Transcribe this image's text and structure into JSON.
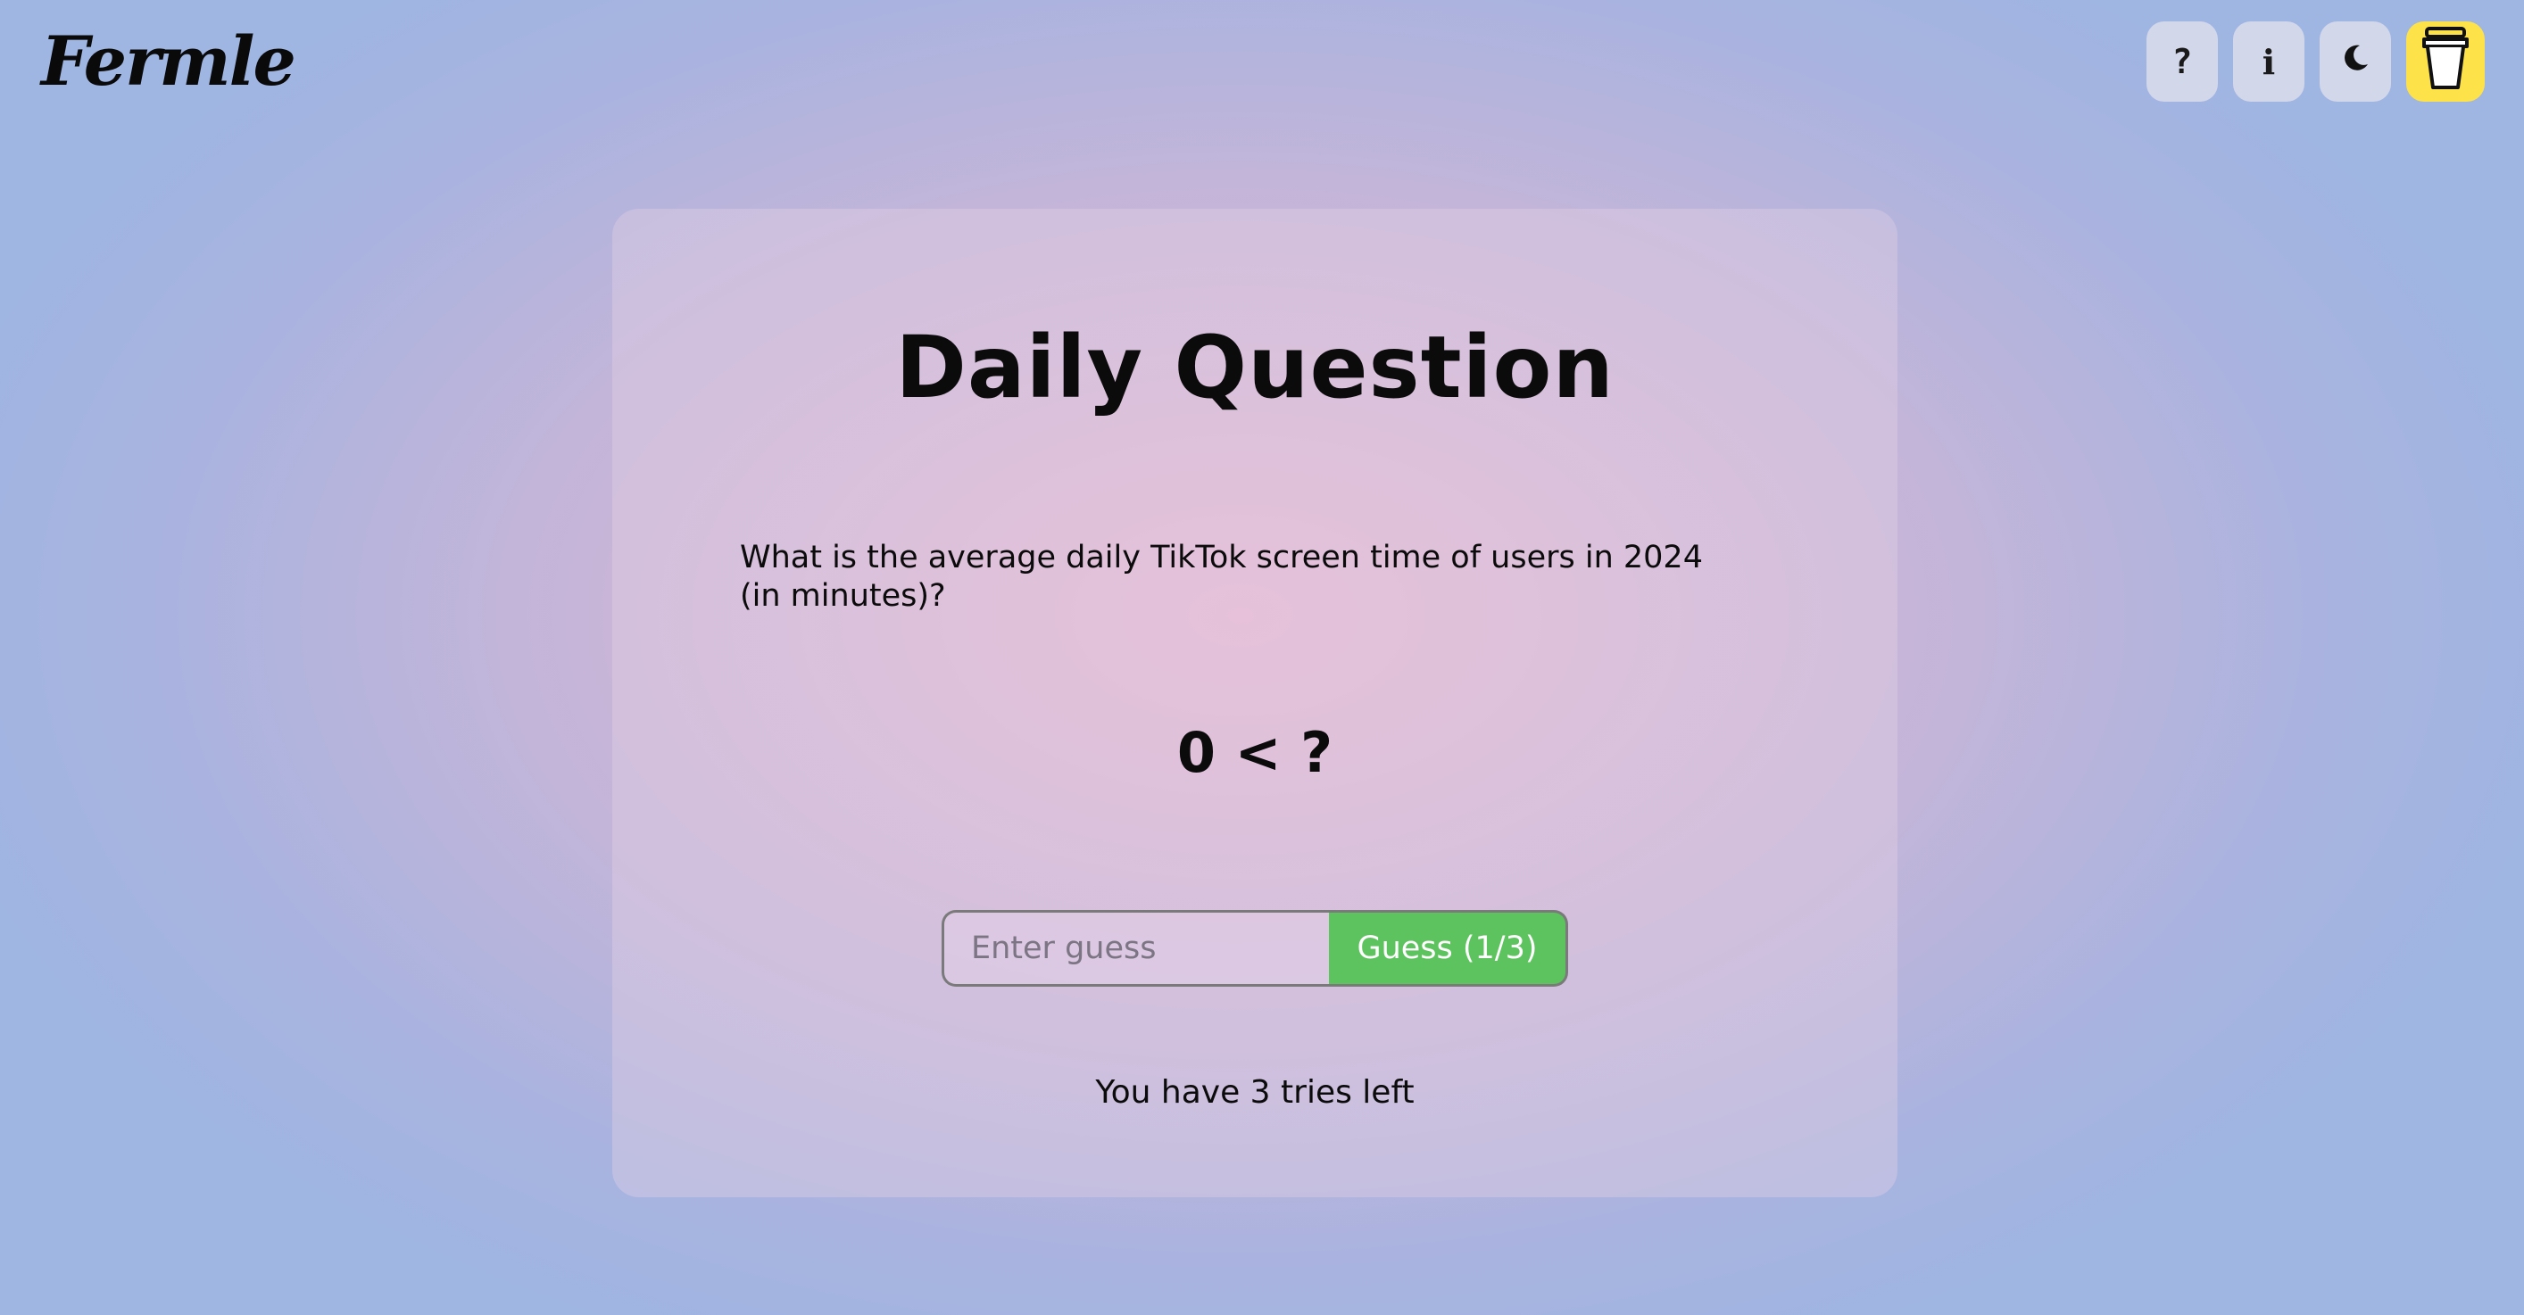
{
  "header": {
    "logo_text": "Fermle",
    "buttons": [
      {
        "name": "help",
        "glyph": "?"
      },
      {
        "name": "info",
        "glyph": "i"
      },
      {
        "name": "dark-mode",
        "glyph": "☾"
      },
      {
        "name": "buy-me-a-coffee",
        "glyph": "coffee-cup"
      }
    ]
  },
  "card": {
    "title": "Daily Question",
    "question": "What is the average daily TikTok screen time of users in 2024 (in minutes)?",
    "hint": "0 < ?",
    "input_placeholder": "Enter guess",
    "guess_button_label": "Guess (1/3)",
    "tries_text": "You have 3 tries left"
  },
  "colors": {
    "guess_button": "#5cc35e",
    "coffee_button": "#fde24a",
    "icon_button": "#d3d7ea"
  }
}
